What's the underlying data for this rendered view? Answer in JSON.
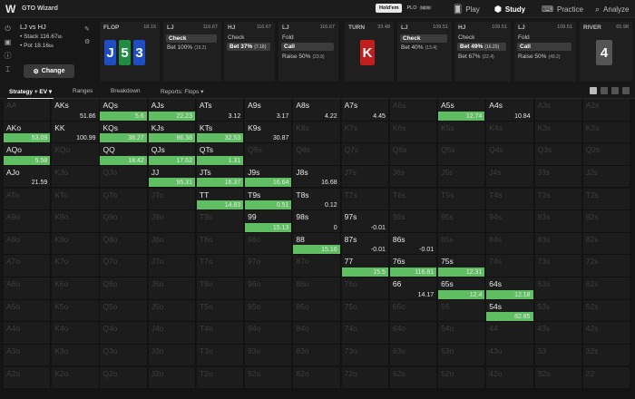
{
  "app": {
    "name": "GTO Wizard",
    "logo": "W"
  },
  "game_switch": {
    "active": "Hold'em",
    "other": "PLO",
    "badge": "NEW"
  },
  "nav": [
    {
      "label": "Play",
      "icon": "play-cards-icon",
      "glyph": "🂠"
    },
    {
      "label": "Study",
      "icon": "study-cap-icon",
      "glyph": "⬢"
    },
    {
      "label": "Practice",
      "icon": "practice-controller-icon",
      "glyph": "⌨"
    },
    {
      "label": "Analyze",
      "icon": "analyze-icon",
      "glyph": "⌕"
    }
  ],
  "matchup": {
    "title": "LJ vs HJ",
    "stack_label": "Stack",
    "stack": "116.67",
    "stack_unit": "bb",
    "pot_label": "Pot",
    "pot": "18.16",
    "pot_unit": "bb"
  },
  "change_label": "Change",
  "panels": {
    "flop": {
      "label": "FLOP",
      "value": "18.16",
      "cards": [
        {
          "rank": "J",
          "color": "#1e4ec2"
        },
        {
          "rank": "5",
          "color": "#1f8c42"
        },
        {
          "rank": "3",
          "color": "#1e4ec2"
        }
      ]
    },
    "p1": {
      "label": "LJ",
      "value": "116.67",
      "sel": "Check",
      "a1": "Bet 100%",
      "a1p": "(19.2)"
    },
    "p2": {
      "label": "HJ",
      "value": "116.67",
      "a0": "Check",
      "sel": "Bet 37%",
      "selp": "(7.16)"
    },
    "p3": {
      "label": "LJ",
      "value": "116.67",
      "a0": "Fold",
      "sel": "Call",
      "a1": "Raise 50%",
      "a1p": "(23.9)"
    },
    "turn": {
      "label": "TURN",
      "value": "33.48",
      "card": {
        "rank": "K",
        "color": "#c21e1e"
      }
    },
    "p4": {
      "label": "LJ",
      "value": "109.51",
      "sel": "Check",
      "a1": "Bet 40%",
      "a1p": "(13.4)"
    },
    "p5": {
      "label": "HJ",
      "value": "109.51",
      "a0": "Check",
      "sel": "Bet 49%",
      "selp": "(16.25)",
      "a1": "Bet 67%",
      "a1p": "(22.4)"
    },
    "p6": {
      "label": "LJ",
      "value": "109.51",
      "a0": "Fold",
      "sel": "Call",
      "a1": "Raise 50%",
      "a1p": "(49.2)"
    },
    "river": {
      "label": "RIVER",
      "value": "65.98",
      "card": {
        "rank": "4",
        "color": "#555"
      }
    }
  },
  "toolbar": {
    "strategy": "Strategy + EV",
    "ranges": "Ranges",
    "breakdown": "Breakdown",
    "reports": "Reports: Flops"
  },
  "grid": {
    "ranks": [
      "A",
      "K",
      "Q",
      "J",
      "T",
      "9",
      "8",
      "7",
      "6",
      "5",
      "4",
      "3",
      "2"
    ],
    "cells": [
      [
        "AA",
        "AKs",
        "AQs",
        "AJs",
        "ATs",
        "A9s",
        "A8s",
        "A7s",
        "A6s",
        "A5s",
        "A4s",
        "A3s",
        "A2s"
      ],
      [
        "AKo",
        "KK",
        "KQs",
        "KJs",
        "KTs",
        "K9s",
        "K8s",
        "K7s",
        "K6s",
        "K5s",
        "K4s",
        "K3s",
        "K2s"
      ],
      [
        "AQo",
        "KQo",
        "QQ",
        "QJs",
        "QTs",
        "Q9s",
        "Q8s",
        "Q7s",
        "Q6s",
        "Q5s",
        "Q4s",
        "Q3s",
        "Q2s"
      ],
      [
        "AJo",
        "KJo",
        "QJo",
        "JJ",
        "JTs",
        "J9s",
        "J8s",
        "J7s",
        "J6s",
        "J5s",
        "J4s",
        "J3s",
        "J2s"
      ],
      [
        "ATo",
        "KTo",
        "QTo",
        "JTo",
        "TT",
        "T9s",
        "T8s",
        "T7s",
        "T6s",
        "T5s",
        "T4s",
        "T3s",
        "T2s"
      ],
      [
        "A9o",
        "K9o",
        "Q9o",
        "J9o",
        "T9o",
        "99",
        "98s",
        "97s",
        "96s",
        "95s",
        "94s",
        "93s",
        "92s"
      ],
      [
        "A8o",
        "K8o",
        "Q8o",
        "J8o",
        "T8o",
        "98o",
        "88",
        "87s",
        "86s",
        "85s",
        "84s",
        "83s",
        "82s"
      ],
      [
        "A7o",
        "K7o",
        "Q7o",
        "J7o",
        "T7o",
        "97o",
        "87o",
        "77",
        "76s",
        "75s",
        "74s",
        "73s",
        "72s"
      ],
      [
        "A6o",
        "K6o",
        "Q6o",
        "J6o",
        "T6o",
        "96o",
        "86o",
        "76o",
        "66",
        "65s",
        "64s",
        "63s",
        "62s"
      ],
      [
        "A5o",
        "K5o",
        "Q5o",
        "J5o",
        "T5o",
        "95o",
        "85o",
        "75o",
        "65o",
        "55",
        "54s",
        "53s",
        "52s"
      ],
      [
        "A4o",
        "K4o",
        "Q4o",
        "J4o",
        "T4o",
        "94o",
        "84o",
        "74o",
        "64o",
        "54o",
        "44",
        "43s",
        "42s"
      ],
      [
        "A3o",
        "K3o",
        "Q3o",
        "J3o",
        "T3o",
        "93o",
        "83o",
        "73o",
        "63o",
        "53o",
        "43o",
        "33",
        "32s"
      ],
      [
        "A2o",
        "K2o",
        "Q2o",
        "J2o",
        "T2o",
        "92o",
        "82o",
        "72o",
        "62o",
        "52o",
        "42o",
        "32o",
        "22"
      ]
    ],
    "active": [
      {
        "hand": "AKs",
        "ev": "51.86",
        "freq": 0
      },
      {
        "hand": "AQs",
        "ev": "5.6",
        "freq": 1.0
      },
      {
        "hand": "AJs",
        "ev": "22.23",
        "freq": 1.0
      },
      {
        "hand": "ATs",
        "ev": "3.12",
        "freq": 0
      },
      {
        "hand": "A9s",
        "ev": "3.17",
        "freq": 0
      },
      {
        "hand": "A8s",
        "ev": "4.22",
        "freq": 0
      },
      {
        "hand": "A7s",
        "ev": "4.45",
        "freq": 0
      },
      {
        "hand": "A5s",
        "ev": "12.74",
        "freq": 1.0
      },
      {
        "hand": "A4s",
        "ev": "10.84",
        "freq": 0
      },
      {
        "hand": "AKo",
        "ev": "53.09",
        "freq": 1.0
      },
      {
        "hand": "KK",
        "ev": "100.99",
        "freq": 0
      },
      {
        "hand": "KQs",
        "ev": "38.27",
        "freq": 1.0
      },
      {
        "hand": "KJs",
        "ev": "96.38",
        "freq": 1.0
      },
      {
        "hand": "KTs",
        "ev": "32.53",
        "freq": 1.0
      },
      {
        "hand": "K9s",
        "ev": "30.87",
        "freq": 0
      },
      {
        "hand": "AQo",
        "ev": "5.58",
        "freq": 1.0
      },
      {
        "hand": "QQ",
        "ev": "18.42",
        "freq": 1.0
      },
      {
        "hand": "QJs",
        "ev": "17.62",
        "freq": 1.0
      },
      {
        "hand": "QTs",
        "ev": "1.31",
        "freq": 1.0
      },
      {
        "hand": "AJo",
        "ev": "21.59",
        "freq": 0
      },
      {
        "hand": "JJ",
        "ev": "95.31",
        "freq": 1.0
      },
      {
        "hand": "JTs",
        "ev": "16.37",
        "freq": 1.0
      },
      {
        "hand": "J9s",
        "ev": "16.64",
        "freq": 1.0
      },
      {
        "hand": "J8s",
        "ev": "16.68",
        "freq": 0
      },
      {
        "hand": "TT",
        "ev": "14.83",
        "freq": 1.0
      },
      {
        "hand": "T9s",
        "ev": "0.51",
        "freq": 1.0
      },
      {
        "hand": "T8s",
        "ev": "0.12",
        "freq": 0
      },
      {
        "hand": "99",
        "ev": "15.13",
        "freq": 1.0
      },
      {
        "hand": "98s",
        "ev": "0",
        "freq": 0
      },
      {
        "hand": "97s",
        "ev": "-0.01",
        "freq": 0
      },
      {
        "hand": "88",
        "ev": "15.16",
        "freq": 1.0
      },
      {
        "hand": "87s",
        "ev": "-0.01",
        "freq": 0
      },
      {
        "hand": "86s",
        "ev": "-0.01",
        "freq": 0
      },
      {
        "hand": "77",
        "ev": "15.5",
        "freq": 1.0
      },
      {
        "hand": "76s",
        "ev": "116.81",
        "freq": 1.0
      },
      {
        "hand": "75s",
        "ev": "12.31",
        "freq": 1.0
      },
      {
        "hand": "66",
        "ev": "14.17",
        "freq": 0
      },
      {
        "hand": "65s",
        "ev": "12.4",
        "freq": 1.0
      },
      {
        "hand": "64s",
        "ev": "12.18",
        "freq": 1.0
      },
      {
        "hand": "54s",
        "ev": "82.85",
        "freq": 1.0
      }
    ]
  },
  "colors": {
    "bar": "#5fbd62",
    "bg": "#141414"
  }
}
